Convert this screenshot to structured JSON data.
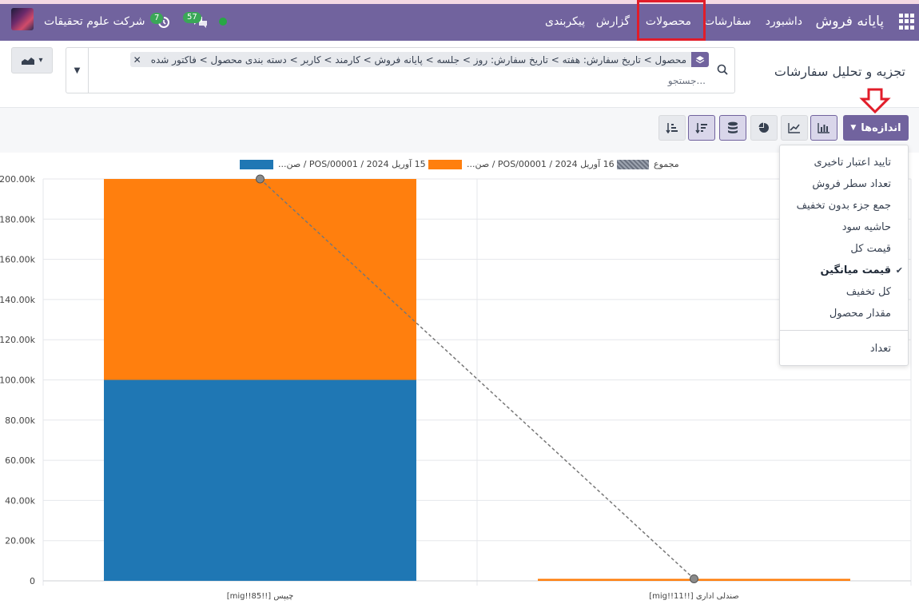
{
  "navbar": {
    "brand": "پایانه فروش",
    "menu": [
      "داشبورد",
      "سفارشات",
      "محصولات",
      "گزارش",
      "پیکربندی"
    ],
    "highlighted_item": "محصولات",
    "company": "شرکت علوم تحقیقات",
    "activity_count": "7",
    "messages_count": "57",
    "colors": {
      "navbar": "#71639e",
      "highlight": "#e11d2a",
      "badge": "#3aa757"
    }
  },
  "control_panel": {
    "title": "تجزیه و تحلیل سفارشات",
    "facet_text": "محصول > تاریخ سفارش: هفته > تاریخ سفارش: روز > جلسه > پایانه فروش > کارمند > کاربر > دسته بندی محصول > فاکتور شده",
    "search_placeholder": "جستجو..."
  },
  "toolbar": {
    "measures_label": "اندازه‌ها"
  },
  "measures_menu": {
    "items": [
      "تایید اعتبار تاخیری",
      "تعداد سطر فروش",
      "جمع جزء بدون تخفیف",
      "حاشیه سود",
      "قیمت کل",
      "قیمت میانگین",
      "کل تخفیف",
      "مقدار محصول"
    ],
    "selected": "قیمت میانگین",
    "count_item": "تعداد"
  },
  "chart_data": {
    "type": "bar",
    "stacked": true,
    "categories": [
      "[mig!!85!!] چیپس",
      "[mig!!11!!] صندلی اداری"
    ],
    "series": [
      {
        "name": "15 آوریل 2024 / POS/00001 / صن...",
        "color": "#1f77b4",
        "values": [
          100000,
          0
        ]
      },
      {
        "name": "16 آوریل 2024 / POS/00001 / صن...",
        "color": "#ff7f0e",
        "values": [
          100000,
          1000
        ]
      }
    ],
    "line_series": {
      "name": "مجموع",
      "values": [
        200000,
        1000
      ]
    },
    "ylim": [
      0,
      200000
    ],
    "yticks": [
      "0",
      "20.00k",
      "40.00k",
      "60.00k",
      "80.00k",
      "100.00k",
      "120.00k",
      "140.00k",
      "160.00k",
      "180.00k",
      "200.00k"
    ],
    "legend_position": "top",
    "grid": true
  }
}
